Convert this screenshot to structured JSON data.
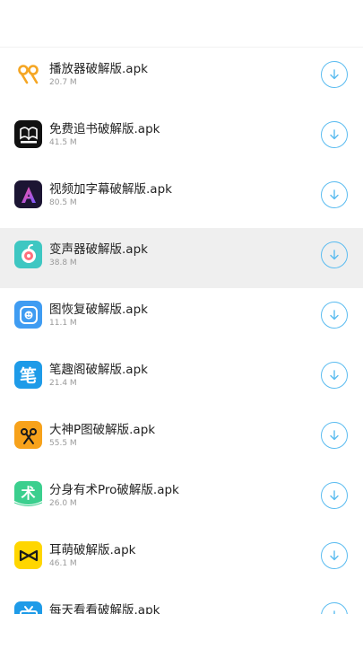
{
  "apps": [
    {
      "name": "播放器破解版.apk",
      "size": "20.7 M",
      "icon": "rr-player-icon",
      "highlight": false
    },
    {
      "name": "免费追书破解版.apk",
      "size": "41.5 M",
      "icon": "book-reader-icon",
      "highlight": false
    },
    {
      "name": "视频加字幕破解版.apk",
      "size": "80.5 M",
      "icon": "subtitle-a-icon",
      "highlight": false
    },
    {
      "name": "变声器破解版.apk",
      "size": "38.8 M",
      "icon": "voice-changer-icon",
      "highlight": true
    },
    {
      "name": "图恢复破解版.apk",
      "size": "11.1 M",
      "icon": "photo-recovery-icon",
      "highlight": false
    },
    {
      "name": "笔趣阁破解版.apk",
      "size": "21.4 M",
      "icon": "bi-pen-icon",
      "highlight": false
    },
    {
      "name": "大神P图破解版.apk",
      "size": "55.5 M",
      "icon": "photo-edit-icon",
      "highlight": false
    },
    {
      "name": "分身有术Pro破解版.apk",
      "size": "26.0 M",
      "icon": "clone-app-icon",
      "highlight": false
    },
    {
      "name": "耳萌破解版.apk",
      "size": "46.1 M",
      "icon": "ear-bow-icon",
      "highlight": false
    },
    {
      "name": "每天看看破解版.apk",
      "size": "",
      "icon": "tv-watch-icon",
      "highlight": false
    }
  ],
  "icon_text": {
    "bi": "笔",
    "shu": "术"
  },
  "colors": {
    "accent": "#5bbcf0",
    "highlight_row": "#efefef"
  }
}
